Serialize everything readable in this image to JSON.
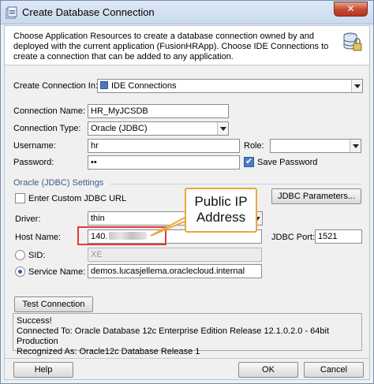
{
  "window": {
    "title": "Create Database Connection",
    "close_glyph": "✕"
  },
  "header": {
    "description": "Choose Application Resources to create a database connection owned by and deployed with the current application (FusionHRApp). Choose IDE Connections to create a connection that can be added to any application."
  },
  "form": {
    "create_in_label": "Create Connection In:",
    "create_in_value": "IDE Connections",
    "connection_name_label": "Connection Name:",
    "connection_name_value": "HR_MyJCSDB",
    "connection_type_label": "Connection Type:",
    "connection_type_value": "Oracle (JDBC)",
    "username_label": "Username:",
    "username_value": "hr",
    "role_label": "Role:",
    "role_value": "",
    "password_label": "Password:",
    "password_value": "••",
    "save_password_label": "Save Password",
    "save_password_checked": true
  },
  "jdbc": {
    "section_title": "Oracle (JDBC) Settings",
    "custom_url_label": "Enter Custom JDBC URL",
    "custom_url_checked": false,
    "params_button": "JDBC Parameters...",
    "driver_label": "Driver:",
    "driver_value": "thin",
    "host_label": "Host Name:",
    "host_value": "140.",
    "port_label": "JDBC Port:",
    "port_value": "1521",
    "sid_label": "SID:",
    "sid_value": "XE",
    "service_label": "Service Name:",
    "service_value": "demos.lucasjellema.oraclecloud.internal",
    "selected_option": "service"
  },
  "test": {
    "button": "Test Connection",
    "status_lines": [
      "Success!",
      "Connected To: Oracle Database 12c Enterprise Edition Release 12.1.0.2.0 - 64bit Production",
      "Recognized As: Oracle12c Database Release 1"
    ]
  },
  "footer": {
    "help_button": "Help",
    "ok_button": "OK",
    "cancel_button": "Cancel"
  },
  "annotation": {
    "callout_line1": "Public IP",
    "callout_line2": "Address",
    "callout_color": "#e9a63c",
    "highlight_color": "#e23a3a"
  },
  "icons": {
    "window_icon": "database-connection-icon",
    "header_icon": "database-icon"
  }
}
